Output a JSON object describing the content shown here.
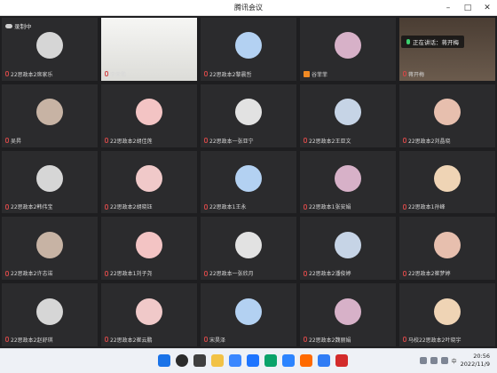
{
  "window": {
    "title": "腾讯会议"
  },
  "status": {
    "recording_label": "录制中",
    "speaking_label": "正在讲话：蒋开梅"
  },
  "participants": [
    {
      "name": "22思政本2席家乐"
    },
    {
      "name": "李荣鹏"
    },
    {
      "name": "22思政本2黎晨哲"
    },
    {
      "name": "谷菲菲"
    },
    {
      "name": "蒋开梅"
    },
    {
      "name": "吴昇"
    },
    {
      "name": "22思政本2胡佳莲"
    },
    {
      "name": "22思政本一张亚宁"
    },
    {
      "name": "22思政本2王亚文"
    },
    {
      "name": "22思政本2刘晶晓"
    },
    {
      "name": "22思政本2韩伟宝"
    },
    {
      "name": "22思政本2胡晓钰"
    },
    {
      "name": "22思政本1王永"
    },
    {
      "name": "22思政本1张安娟"
    },
    {
      "name": "22思政本1孙峰"
    },
    {
      "name": "22思政本2许志诺"
    },
    {
      "name": "22思政本1刘子尧"
    },
    {
      "name": "22思政本一张欣月"
    },
    {
      "name": "22思政本2潘俊婷"
    },
    {
      "name": "22思政本2崔梦婷"
    },
    {
      "name": "22思政本2赵舒琪"
    },
    {
      "name": "22思政本2崔云鹏"
    },
    {
      "name": "宋昊泽"
    },
    {
      "name": "22思政本2魏丽娟"
    },
    {
      "name": "马校22思政本2叶晓宇"
    }
  ],
  "taskbar": {
    "time": "20:56",
    "date": "2022/11/9",
    "ime": "中"
  },
  "icons": [
    "windows-start-icon",
    "search-icon",
    "task-view-icon",
    "file-explorer-icon",
    "edge-icon",
    "tencent-meeting-icon"
  ]
}
